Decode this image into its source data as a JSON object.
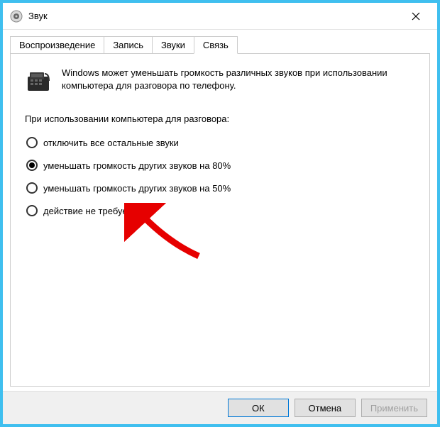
{
  "window": {
    "title": "Звук"
  },
  "tabs": {
    "playback": "Воспроизведение",
    "recording": "Запись",
    "sounds": "Звуки",
    "communications": "Связь"
  },
  "content": {
    "intro": "Windows может уменьшать громкость различных звуков при использовании компьютера для разговора по телефону.",
    "group_label": "При использовании компьютера для разговора:",
    "options": {
      "mute": "отключить все остальные звуки",
      "reduce80": "уменьшать громкость других звуков на 80%",
      "reduce50": "уменьшать громкость других звуков на 50%",
      "none": "действие не требуется"
    }
  },
  "buttons": {
    "ok": "ОК",
    "cancel": "Отмена",
    "apply": "Применить"
  }
}
